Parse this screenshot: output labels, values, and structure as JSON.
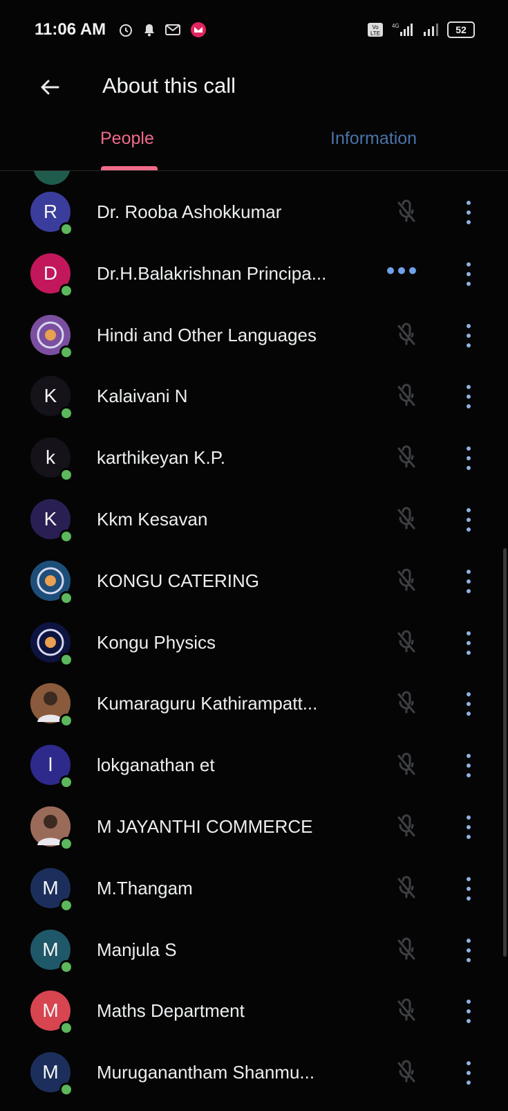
{
  "status_bar": {
    "time": "11:06 AM",
    "battery": "52",
    "icons": [
      "alarm-icon",
      "notification-bell-icon",
      "gmail-icon",
      "app-badge-icon",
      "volte-icon",
      "4g-signal-icon",
      "signal-icon",
      "battery-icon"
    ]
  },
  "header": {
    "title": "About this call",
    "back_icon": "arrow-back-icon"
  },
  "tabs": [
    {
      "label": "People",
      "active": true
    },
    {
      "label": "Information",
      "active": false
    }
  ],
  "colors": {
    "accent": "#f06a8a",
    "online": "#5cb85c",
    "tab_inactive": "#4a73a8",
    "background": "#050505"
  },
  "participants": [
    {
      "name": "Dr. Rooba Ashokkumar",
      "initial": "R",
      "avatar_color": "#3a3d9c",
      "speaking": false,
      "status_icon": "mic-off-icon"
    },
    {
      "name": "Dr.H.Balakrishnan Principa...",
      "initial": "D",
      "avatar_color": "#c2185b",
      "speaking": true,
      "status_icon": "speaking-dots-icon"
    },
    {
      "name": "Hindi and Other Languages",
      "initial": "",
      "avatar_color": "#7b4fa0",
      "speaking": false,
      "status_icon": "mic-off-icon",
      "avatar_type": "logo"
    },
    {
      "name": "Kalaivani N",
      "initial": "K",
      "avatar_color": "#15121a",
      "speaking": false,
      "status_icon": "mic-off-icon"
    },
    {
      "name": "karthikeyan K.P.",
      "initial": "k",
      "avatar_color": "#15121a",
      "speaking": false,
      "status_icon": "mic-off-icon"
    },
    {
      "name": "Kkm Kesavan",
      "initial": "K",
      "avatar_color": "#2a1f52",
      "speaking": false,
      "status_icon": "mic-off-icon"
    },
    {
      "name": "KONGU CATERING",
      "initial": "",
      "avatar_color": "#1d4e7a",
      "speaking": false,
      "status_icon": "mic-off-icon",
      "avatar_type": "logo"
    },
    {
      "name": "Kongu Physics",
      "initial": "",
      "avatar_color": "#0d1440",
      "speaking": false,
      "status_icon": "mic-off-icon",
      "avatar_type": "logo"
    },
    {
      "name": "Kumaraguru Kathirampatt...",
      "initial": "",
      "avatar_color": "#8a5a3c",
      "speaking": false,
      "status_icon": "mic-off-icon",
      "avatar_type": "photo"
    },
    {
      "name": "lokganathan et",
      "initial": "l",
      "avatar_color": "#2e2a8c",
      "speaking": false,
      "status_icon": "mic-off-icon"
    },
    {
      "name": "M JAYANTHI COMMERCE",
      "initial": "",
      "avatar_color": "#9b6b5a",
      "speaking": false,
      "status_icon": "mic-off-icon",
      "avatar_type": "photo"
    },
    {
      "name": "M.Thangam",
      "initial": "M",
      "avatar_color": "#1c2f5c",
      "speaking": false,
      "status_icon": "mic-off-icon"
    },
    {
      "name": "Manjula S",
      "initial": "M",
      "avatar_color": "#1f5868",
      "speaking": false,
      "status_icon": "mic-off-icon"
    },
    {
      "name": "Maths Department",
      "initial": "M",
      "avatar_color": "#d64550",
      "speaking": false,
      "status_icon": "mic-off-icon"
    },
    {
      "name": "Muruganantham Shanmu...",
      "initial": "M",
      "avatar_color": "#1c2f5c",
      "speaking": false,
      "status_icon": "mic-off-icon"
    }
  ]
}
